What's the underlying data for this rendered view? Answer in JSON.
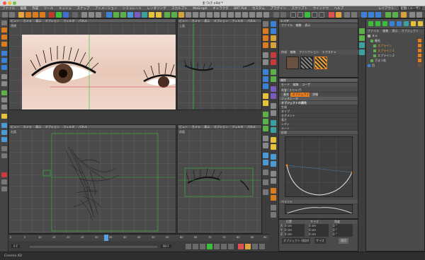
{
  "window": {
    "title": "まつげ.c4d *"
  },
  "menubar": {
    "items": [
      "ファイル",
      "編集",
      "作成",
      "ツール",
      "メッシュ",
      "スナップ",
      "アニメーション",
      "シミュレート",
      "レンダリング",
      "スカルプト",
      "MoGraph",
      "キャラクタ",
      "BRT Pull",
      "カスタム",
      "プラグイン",
      "スクリプト",
      "ウインドウ",
      "ヘルプ"
    ],
    "layout_label": "レイアウト:",
    "layout_value": "起動 (ユーザ)"
  },
  "viewports": {
    "top_left": {
      "menu": [
        "ビュー",
        "カメラ",
        "表示",
        "オプション",
        "フィルタ",
        "パネル"
      ],
      "label": "透視"
    },
    "top_right": {
      "menu": [
        "ビュー",
        "カメラ",
        "表示",
        "オプション",
        "フィルタ",
        "パネル"
      ],
      "label": "上面"
    },
    "bottom_left": {
      "menu": [
        "ビュー",
        "カメラ",
        "表示",
        "オプション",
        "フィルタ",
        "パネル"
      ],
      "label": "右面"
    },
    "bottom_right": {
      "menu": [
        "ビュー",
        "カメラ",
        "表示",
        "オプション",
        "フィルタ",
        "パネル"
      ],
      "label": "前面"
    }
  },
  "material_panel": {
    "header": "レイヤ",
    "menu": [
      "ファイル",
      "編集",
      "表示"
    ],
    "tabs": [
      "作成",
      "編集",
      "ファンクション",
      "テクスチャ"
    ]
  },
  "attributes": {
    "header": "属性",
    "menu": [
      "モード",
      "編集",
      "ユーザ"
    ],
    "object_name": "毛髪 [スカルプ]",
    "tabs": [
      "基本",
      "オブジェクト",
      "詳細"
    ],
    "subtab": "ジェネレータ",
    "section_title": "オブジェクトの属性",
    "rows": [
      "生成",
      "タイプ",
      "セグメント",
      "長さ",
      "レディ",
      "ルート"
    ],
    "curve_title": "形状",
    "lower_section": "ペイント"
  },
  "coords": {
    "headers": [
      "位置",
      "サイズ",
      "角度"
    ],
    "rows": [
      {
        "axis": "X",
        "pos": "0 cm",
        "size": "0 cm",
        "ang": "0 °"
      },
      {
        "axis": "Y",
        "pos": "0 cm",
        "size": "0 cm",
        "ang": "0 °"
      },
      {
        "axis": "Z",
        "pos": "0 cm",
        "size": "0 cm",
        "ang": "0 °"
      }
    ],
    "mode": "オブジェクト (相対)",
    "size_mode": "サイズ",
    "apply": "適用"
  },
  "objects": {
    "menu": [
      "ファイル",
      "編集",
      "表示",
      "オブジェクト"
    ],
    "items": [
      "ヌル",
      "睫毛",
      "スプライン",
      "スプライン.1",
      "スプライン.2",
      "下まつ毛",
      "目"
    ]
  },
  "timeline": {
    "frame_start": "0 F",
    "frame_end": "90 F",
    "ticks": [
      "0",
      "5",
      "10",
      "15",
      "20",
      "25",
      "30",
      "35",
      "40",
      "45",
      "50",
      "55",
      "60",
      "65",
      "70",
      "75",
      "80",
      "85",
      "90"
    ]
  },
  "status": {
    "text": "Cinema 4D"
  },
  "colors": {
    "accent": "#e87d1e",
    "viewport_bg": "#4a4a4a",
    "grid": "#555555",
    "axis_green": "#3bbf3b",
    "axis_red": "#c93a3a"
  }
}
